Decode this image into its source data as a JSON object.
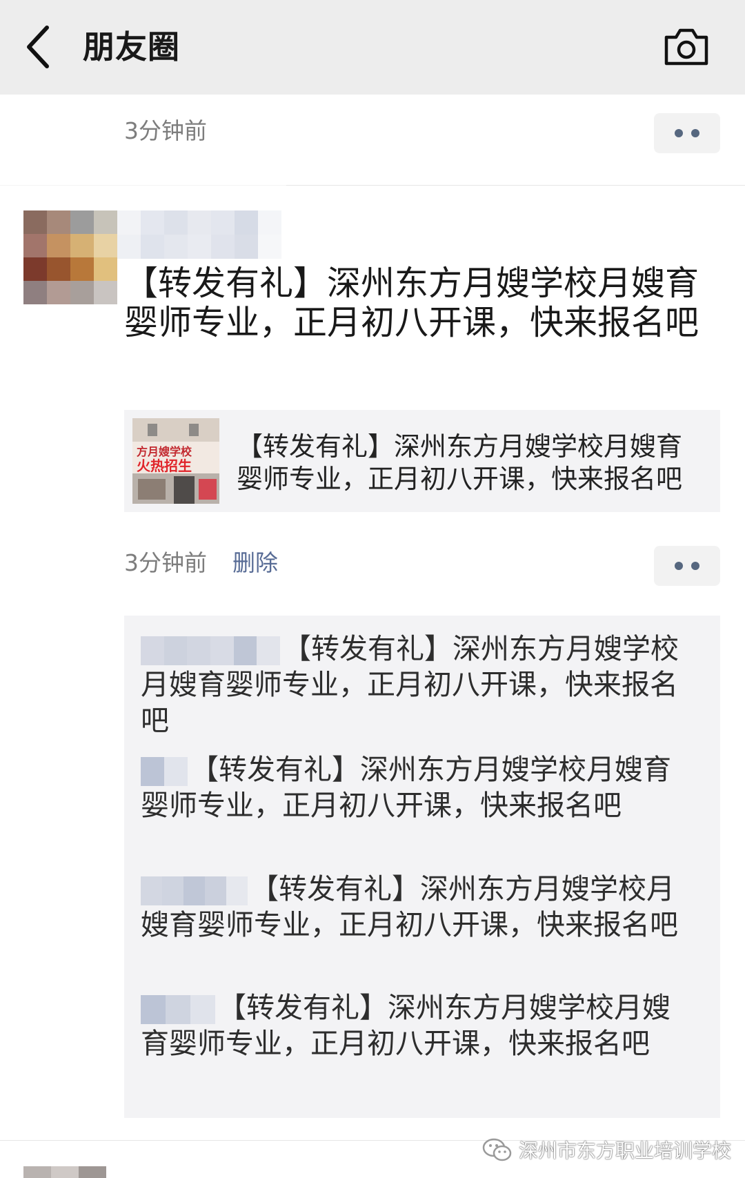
{
  "nav": {
    "title": "朋友圈"
  },
  "top_entry": {
    "time": "3分钟前"
  },
  "post": {
    "text": "【转发有礼】深州东方月嫂学校月嫂育婴师专业，正月初八开课，快来报名吧",
    "link_title": "【转发有礼】深州东方月嫂学校月嫂育婴师专业，正月初八开课，快来报名吧",
    "thumb_sign_line1": "方月嫂学校",
    "thumb_sign_line2": "火热招生",
    "time": "3分钟前",
    "delete_label": "删除"
  },
  "comments": [
    {
      "text": "【转发有礼】深州东方月嫂学校月嫂育婴师专业，正月初八开课，快来报名吧"
    },
    {
      "text": "【转发有礼】深州东方月嫂学校月嫂育婴师专业，正月初八开课，快来报名吧"
    },
    {
      "text": "【转发有礼】深州东方月嫂学校月嫂育婴师专业，正月初八开课，快来报名吧"
    },
    {
      "text": "【转发有礼】深州东方月嫂学校月嫂育婴师专业，正月初八开课，快来报名吧"
    }
  ],
  "watermark": {
    "text": "深州市东方职业培训学校"
  },
  "icons": {
    "back": "chevron-left-icon",
    "camera": "camera-icon",
    "more": "more-dots-icon",
    "wechat": "wechat-logo-icon"
  },
  "colors": {
    "nav_bg": "#ededed",
    "link_blue": "#576b95",
    "card_bg": "#f3f3f5",
    "time_gray": "#7d7d7d"
  }
}
